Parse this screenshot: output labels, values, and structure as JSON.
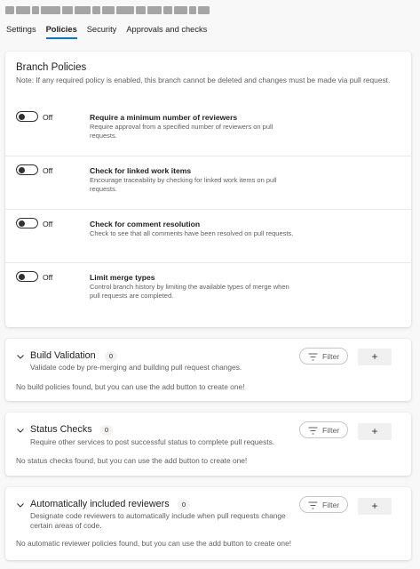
{
  "header": {
    "path_redacted": true
  },
  "tabs": [
    {
      "label": "Settings",
      "active": false
    },
    {
      "label": "Policies",
      "active": true
    },
    {
      "label": "Security",
      "active": false
    },
    {
      "label": "Approvals and checks",
      "active": false
    }
  ],
  "branch_policies": {
    "title": "Branch Policies",
    "note": "Note: If any required policy is enabled, this branch cannot be deleted and changes must be made via pull request.",
    "policies": [
      {
        "toggle_state": "Off",
        "title": "Require a minimum number of reviewers",
        "description": "Require approval from a specified number of reviewers on pull requests."
      },
      {
        "toggle_state": "Off",
        "title": "Check for linked work items",
        "description": "Encourage traceability by checking for linked work items on pull requests."
      },
      {
        "toggle_state": "Off",
        "title": "Check for comment resolution",
        "description": "Check to see that all comments have been resolved on pull requests."
      },
      {
        "toggle_state": "Off",
        "title": "Limit merge types",
        "description": "Control branch history by limiting the available types of merge when pull requests are completed."
      }
    ]
  },
  "sections": [
    {
      "title": "Build Validation",
      "count": "0",
      "description": "Validate code by pre-merging and building pull request changes.",
      "filter_label": "Filter",
      "add_label": "+",
      "empty_message": "No build policies found, but you can use the add button to create one!"
    },
    {
      "title": "Status Checks",
      "count": "0",
      "description": "Require other services to post successful status to complete pull requests.",
      "filter_label": "Filter",
      "add_label": "+",
      "empty_message": "No status checks found, but you can use the add button to create one!"
    },
    {
      "title": "Automatically included reviewers",
      "count": "0",
      "description": "Designate code reviewers to automatically include when pull requests change certain areas of code.",
      "filter_label": "Filter",
      "add_label": "+",
      "empty_message": "No automatic reviewer policies found, but you can use the add button to create one!"
    }
  ],
  "colors": {
    "accent": "#0078d4",
    "background": "#f8f8f8",
    "card": "#ffffff",
    "secondary_text": "#605e5c"
  }
}
